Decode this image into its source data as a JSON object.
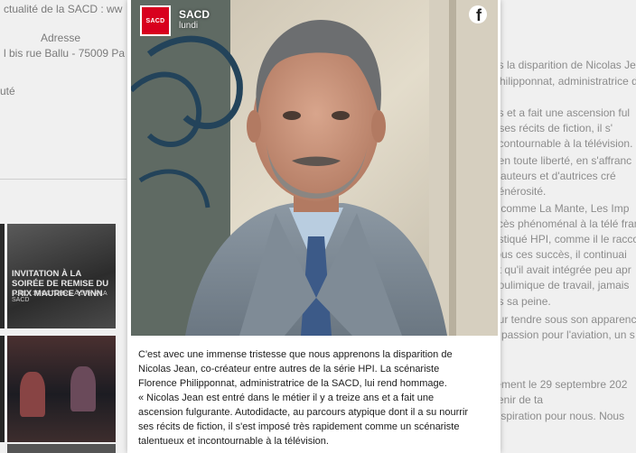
{
  "background_page": {
    "left": {
      "top_text": "ctualité de la SACD : ww",
      "address_label": "Adresse",
      "address_value": "l bis rue Ballu - 75009 Pa",
      "misc": "uté"
    },
    "thumbnails": [
      {
        "title": "INVITATION À LA SOIRÉE DE REMISE DU PRIX MAURICE YVINN",
        "subtitle": "LUNDI 13 OCTOBRE À 19H À LA SACD"
      }
    ],
    "right_lines": [
      "ns la disparition de Nicolas Jea",
      "Philipponnat, administratrice d",
      "ns et a fait une ascension ful",
      "r ses récits de fiction, il s'",
      "ncontournable à la télévision.",
      "t en toute liberté, en s'affranc",
      "d'auteurs et d'autrices cré",
      "générosité.",
      "s comme La Mante, Les Imp",
      "ccès phénoménal à la télé fran",
      "ostiqué HPI, comme il le racco",
      "tous ces succès, il continuai",
      "nt qu'il avait intégrée peu apr",
      "boulimique de travail, jamais",
      "as sa peine.",
      "eur tendre sous son apparenc",
      "e passion pour l'aviation, un s",
      "tement le 29 septembre 202",
      "venir de ta",
      "inspiration pour nous. Nous"
    ]
  },
  "post": {
    "page_name": "SACD",
    "date": "lundi",
    "avatar_text": "SACD",
    "fb_icon": "facebook-icon",
    "caption_lines": [
      "C'est avec une immense tristesse que nous apprenons la disparition de",
      "Nicolas Jean, co-créateur entre autres de la série HPI. La scénariste",
      "Florence Philipponnat, administratrice de la SACD, lui rend hommage.",
      "« Nicolas Jean est entré dans le métier il y a treize ans et a fait une",
      "ascension fulgurante. Autodidacte, au parcours atypique dont il a su nourrir",
      "ses récits de fiction, il s'est imposé très rapidement comme un scénariste",
      "talentueux et incontournable à la télévision."
    ]
  },
  "colors": {
    "brand_red": "#d8001e",
    "card_bg": "#ffffff",
    "text": "#1c1c1c",
    "background_text": "#8c8c8c"
  }
}
